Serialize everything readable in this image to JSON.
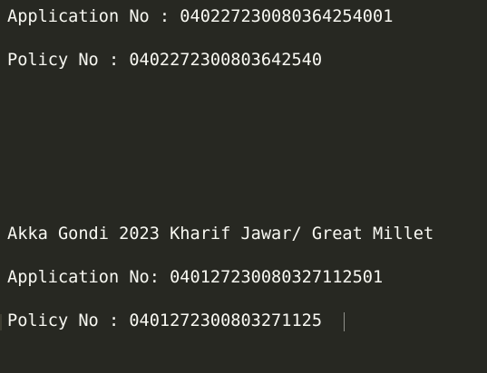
{
  "editor": {
    "lines": [
      "Application No : 040227230080364254001",
      "Policy No : 0402272300803642540",
      "Akka Gondi 2023 Kharif Jawar/ Great Millet",
      "Application No: 040127230080327112501",
      "Policy No : 0401272300803271125"
    ]
  },
  "colors": {
    "background": "#272822",
    "text": "#f8f8f2"
  }
}
